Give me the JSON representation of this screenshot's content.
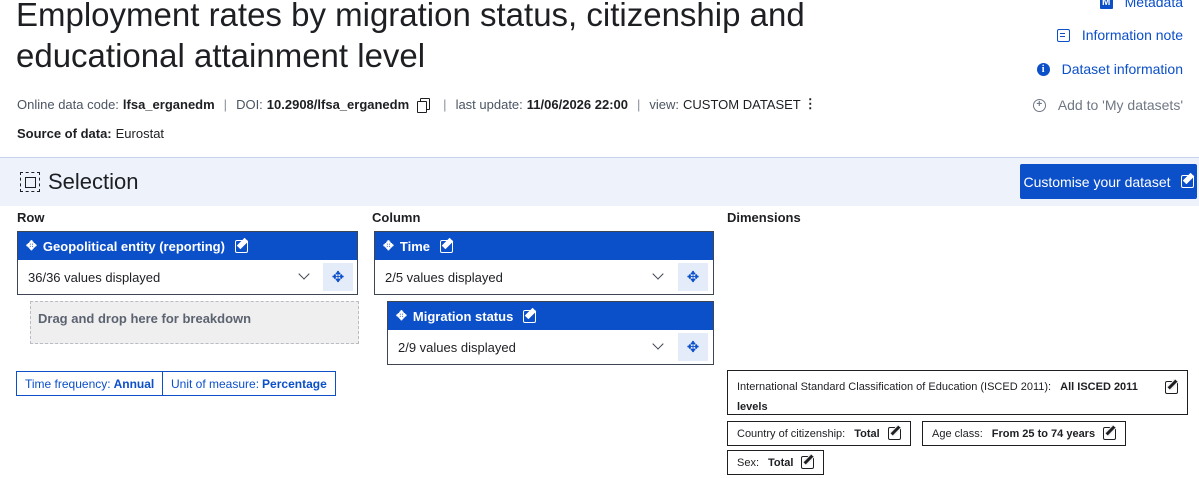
{
  "header": {
    "title": "Employment rates by migration status, citizenship and educational attainment level"
  },
  "side_links": [
    {
      "label": "Metadata",
      "icon": "metadata-icon"
    },
    {
      "label": "Information note",
      "icon": "note-icon"
    },
    {
      "label": "Dataset information",
      "icon": "info-icon"
    },
    {
      "label": "Add to 'My datasets'",
      "icon": "add-icon"
    }
  ],
  "meta": {
    "code_label": "Online data code:",
    "code": "lfsa_erganedm",
    "doi_label": "DOI:",
    "doi": "10.2908/lfsa_erganedm",
    "update_label": "last update:",
    "update": "11/06/2026 22:00",
    "view_label": "view:",
    "view": "CUSTOM DATASET",
    "sep": "|",
    "kebab": "⋮"
  },
  "source": {
    "label": "Source of data:",
    "value": "Eurostat"
  },
  "selection": {
    "title": "Selection",
    "customise_label": "Customise your dataset"
  },
  "columns": {
    "row": "Row",
    "column": "Column",
    "dimensions": "Dimensions"
  },
  "row_dims": [
    {
      "title": "Geopolitical entity (reporting)",
      "value": "36/36 values displayed"
    }
  ],
  "column_dims": [
    {
      "title": "Time",
      "value": "2/5 values displayed"
    },
    {
      "title": "Migration status",
      "value": "2/9 values displayed"
    }
  ],
  "drop_text": "Drag and drop here for breakdown",
  "row_filters": [
    {
      "label": "Time frequency:",
      "value": "Annual"
    },
    {
      "label": "Unit of measure:",
      "value": "Percentage"
    }
  ],
  "dim_filters": [
    {
      "label": "International Standard Classification of Education (ISCED 2011):",
      "value": "All ISCED 2011 levels"
    },
    {
      "label": "Country of citizenship:",
      "value": "Total"
    },
    {
      "label": "Age class:",
      "value": "From 25 to 74 years"
    },
    {
      "label": "Sex:",
      "value": "Total"
    }
  ],
  "colors": {
    "accent": "#0b4fc9",
    "selection_bg": "#eef2fb",
    "text": "#1d1f23"
  }
}
